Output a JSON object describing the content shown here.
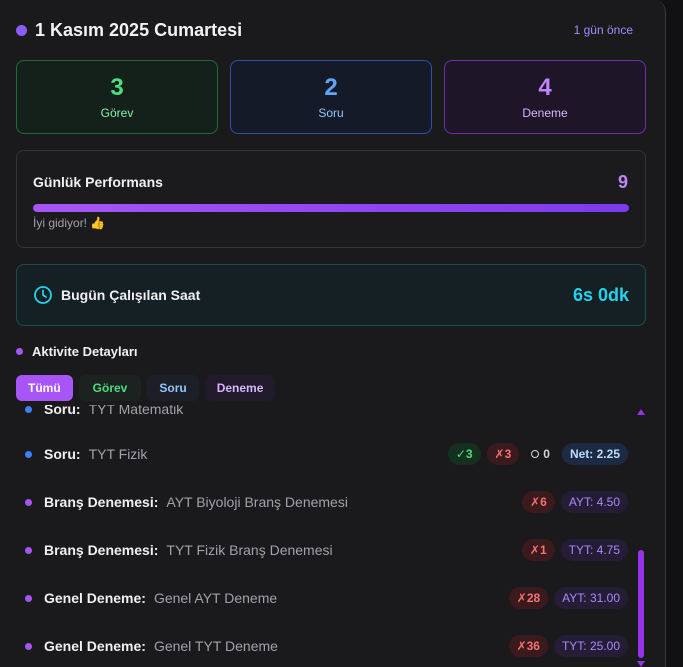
{
  "header": {
    "title": "1 Kasım 2025 Cumartesi",
    "ago": "1 gün önce"
  },
  "stats": [
    {
      "value": "3",
      "label": "Görev"
    },
    {
      "value": "2",
      "label": "Soru"
    },
    {
      "value": "4",
      "label": "Deneme"
    }
  ],
  "performance": {
    "title": "Günlük Performans",
    "score": "9",
    "progress_percent": 100,
    "note": "İyi gidiyor! 👍"
  },
  "hours": {
    "label": "Bugün Çalışılan Saat",
    "value": "6s 0dk"
  },
  "activity": {
    "title": "Aktivite Detayları"
  },
  "filters": [
    "Tümü",
    "Görev",
    "Soru",
    "Deneme"
  ],
  "rows": [
    {
      "kind": "Soru:",
      "desc": "TYT Matematik",
      "color": "#3b82f6",
      "partial": true,
      "chips": []
    },
    {
      "kind": "Soru:",
      "desc": "TYT Fizik",
      "color": "#3b82f6",
      "chips": [
        {
          "type": "ok",
          "text": "✓3"
        },
        {
          "type": "bad",
          "text": "✗3"
        },
        {
          "type": "empty",
          "text": "0"
        },
        {
          "type": "net",
          "text": "Net: 2.25"
        }
      ]
    },
    {
      "kind": "Branş Denemesi:",
      "desc": "AYT Biyoloji Branş Denemesi",
      "color": "#a855f7",
      "chips": [
        {
          "type": "bad",
          "text": "✗6"
        },
        {
          "type": "score",
          "text": "AYT: 4.50"
        }
      ]
    },
    {
      "kind": "Branş Denemesi:",
      "desc": "TYT Fizik Branş Denemesi",
      "color": "#a855f7",
      "chips": [
        {
          "type": "bad",
          "text": "✗1"
        },
        {
          "type": "score",
          "text": "TYT: 4.75"
        }
      ]
    },
    {
      "kind": "Genel Deneme:",
      "desc": "Genel AYT Deneme",
      "color": "#a855f7",
      "chips": [
        {
          "type": "bad",
          "text": "✗28"
        },
        {
          "type": "score",
          "text": "AYT: 31.00"
        }
      ]
    },
    {
      "kind": "Genel Deneme:",
      "desc": "Genel TYT Deneme",
      "color": "#a855f7",
      "chips": [
        {
          "type": "bad",
          "text": "✗36"
        },
        {
          "type": "score",
          "text": "TYT: 25.00"
        }
      ]
    }
  ],
  "colors": {
    "accent": "#a855f7",
    "green": "#4ade80",
    "blue": "#60a5fa",
    "cyan": "#22d3ee",
    "red": "#f87171"
  }
}
